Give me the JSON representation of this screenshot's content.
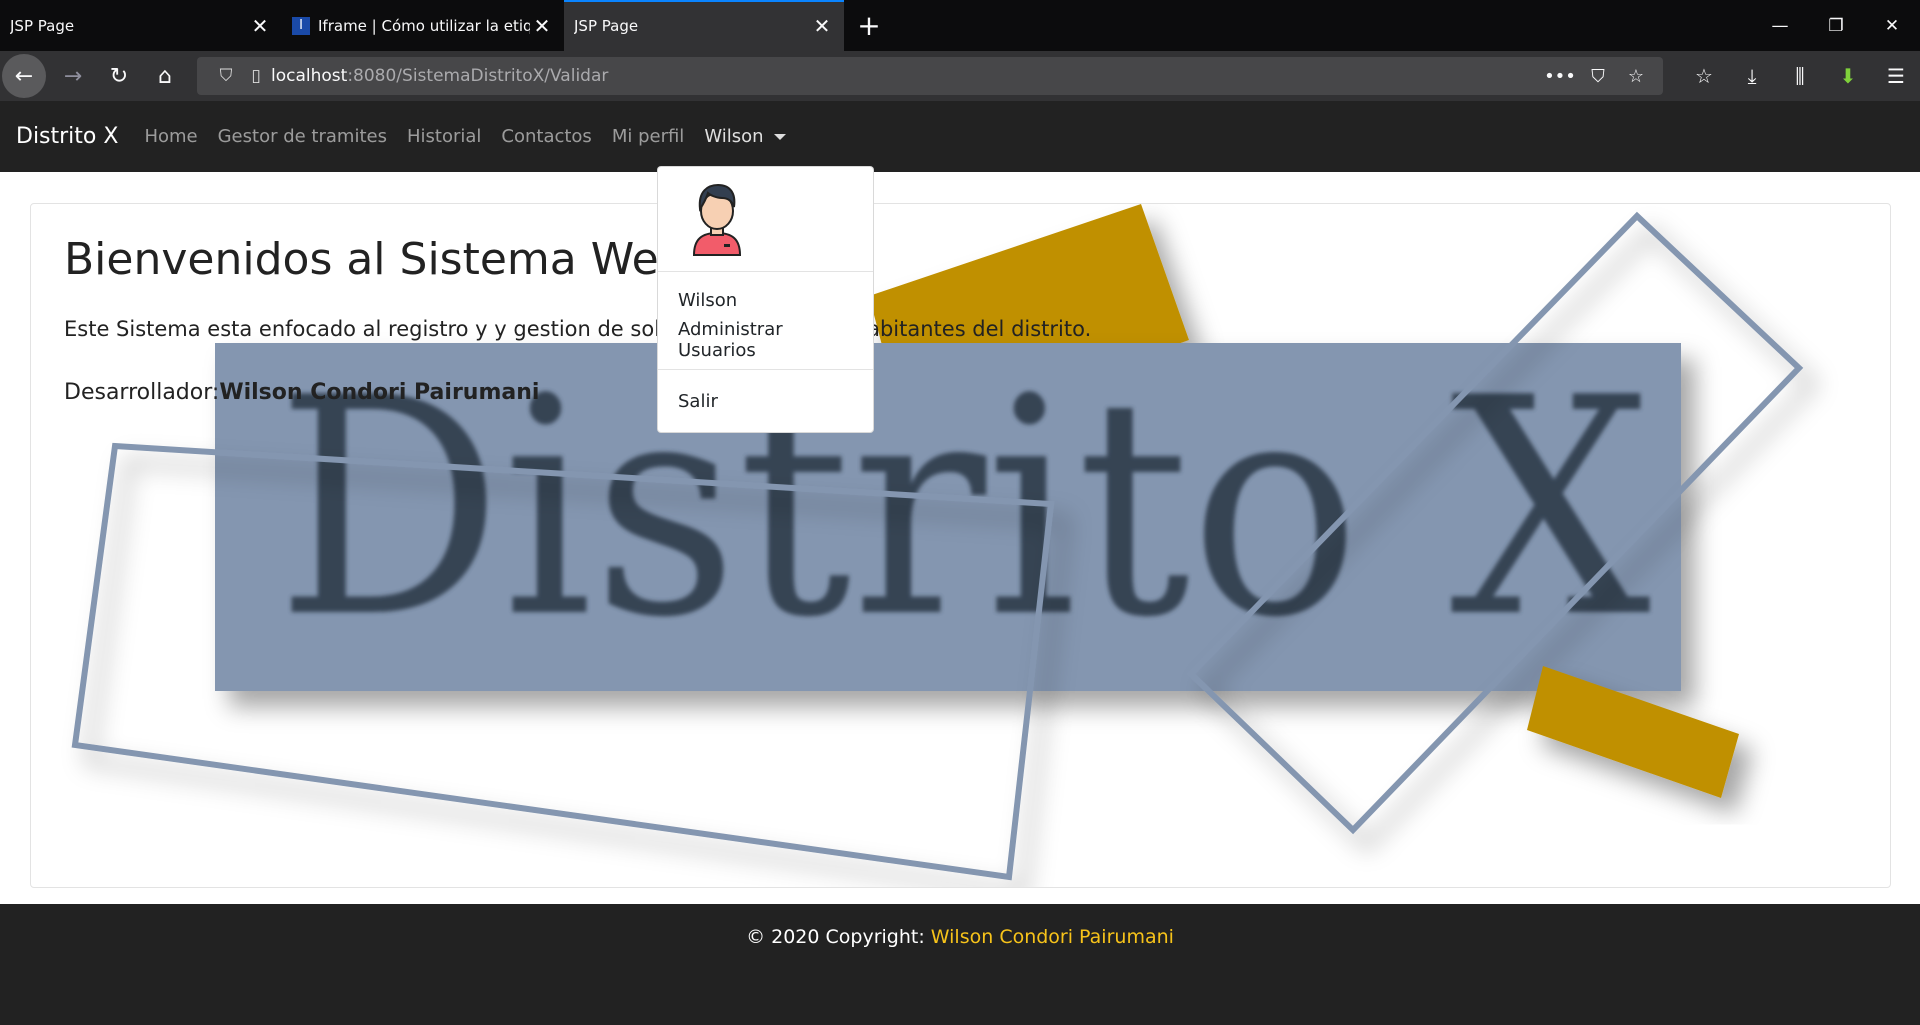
{
  "browser": {
    "tabs": [
      {
        "title": "JSP Page",
        "active": false,
        "favicon": ""
      },
      {
        "title": "Iframe | Cómo utilizar la etiqu",
        "active": false,
        "favicon": "I"
      },
      {
        "title": "JSP Page",
        "active": true,
        "favicon": ""
      }
    ],
    "url_host": "localhost",
    "url_path": ":8080/SistemaDistritoX/Validar"
  },
  "nav": {
    "brand": "Distrito X",
    "links": [
      "Home",
      "Gestor de tramites",
      "Historial",
      "Contactos",
      "Mi perfil"
    ],
    "user": "Wilson"
  },
  "dropdown": {
    "items": [
      "Wilson",
      "Administrar Usuarios"
    ],
    "logout": "Salir"
  },
  "main": {
    "title": "Bienvenidos al Sistema Web D",
    "lead_left": "Este Sistema esta enfocado al registro y y gestion de solicit",
    "lead_right": "los habitantes del distrito.",
    "dev_label": "Desarrollador:",
    "dev_name": "Wilson Condori Pairumani",
    "hero_text": "Distrito X",
    "colors": {
      "panel": "#8496b0",
      "gold": "#c09000",
      "text_dark": "#333f50",
      "frame": "#8496b0"
    }
  },
  "footer": {
    "copy_label": "© 2020 Copyright: ",
    "copy_name": "Wilson Condori Pairumani"
  }
}
